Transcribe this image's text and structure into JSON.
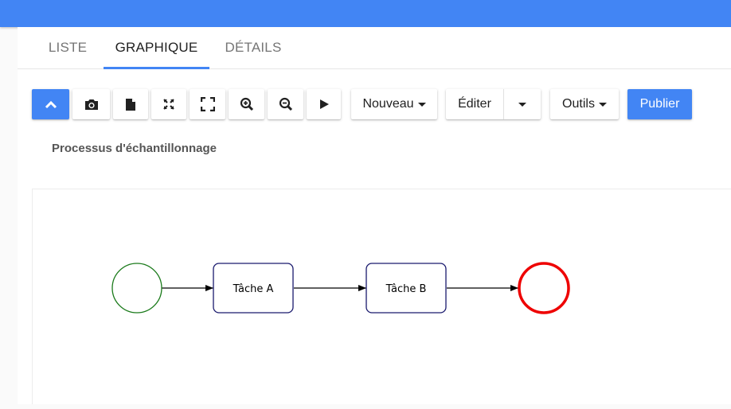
{
  "header": {
    "color": "#4285f4"
  },
  "tabs": [
    {
      "label": "LISTE",
      "active": false
    },
    {
      "label": "GRAPHIQUE",
      "active": true
    },
    {
      "label": "DÉTAILS",
      "active": false
    }
  ],
  "toolbar": {
    "icon_buttons": [
      "chevron-up-icon",
      "camera-icon",
      "document-icon",
      "fit-icon",
      "fullscreen-icon",
      "zoom-in-icon",
      "zoom-out-icon",
      "play-icon"
    ],
    "nouveau_label": "Nouveau",
    "editer_label": "Éditer",
    "outils_label": "Outils",
    "publier_label": "Publier"
  },
  "process_title": "Processus d'échantillonnage",
  "diagram": {
    "nodes": [
      {
        "id": "start",
        "type": "start-event",
        "color": "#1a7a1a"
      },
      {
        "id": "taskA",
        "type": "task",
        "label": "Tâche A",
        "color": "#1a1a6e"
      },
      {
        "id": "taskB",
        "type": "task",
        "label": "Tâche B",
        "color": "#1a1a6e"
      },
      {
        "id": "end",
        "type": "end-event",
        "color": "#ee0000"
      }
    ],
    "edges": [
      {
        "from": "start",
        "to": "taskA"
      },
      {
        "from": "taskA",
        "to": "taskB"
      },
      {
        "from": "taskB",
        "to": "end"
      }
    ]
  }
}
